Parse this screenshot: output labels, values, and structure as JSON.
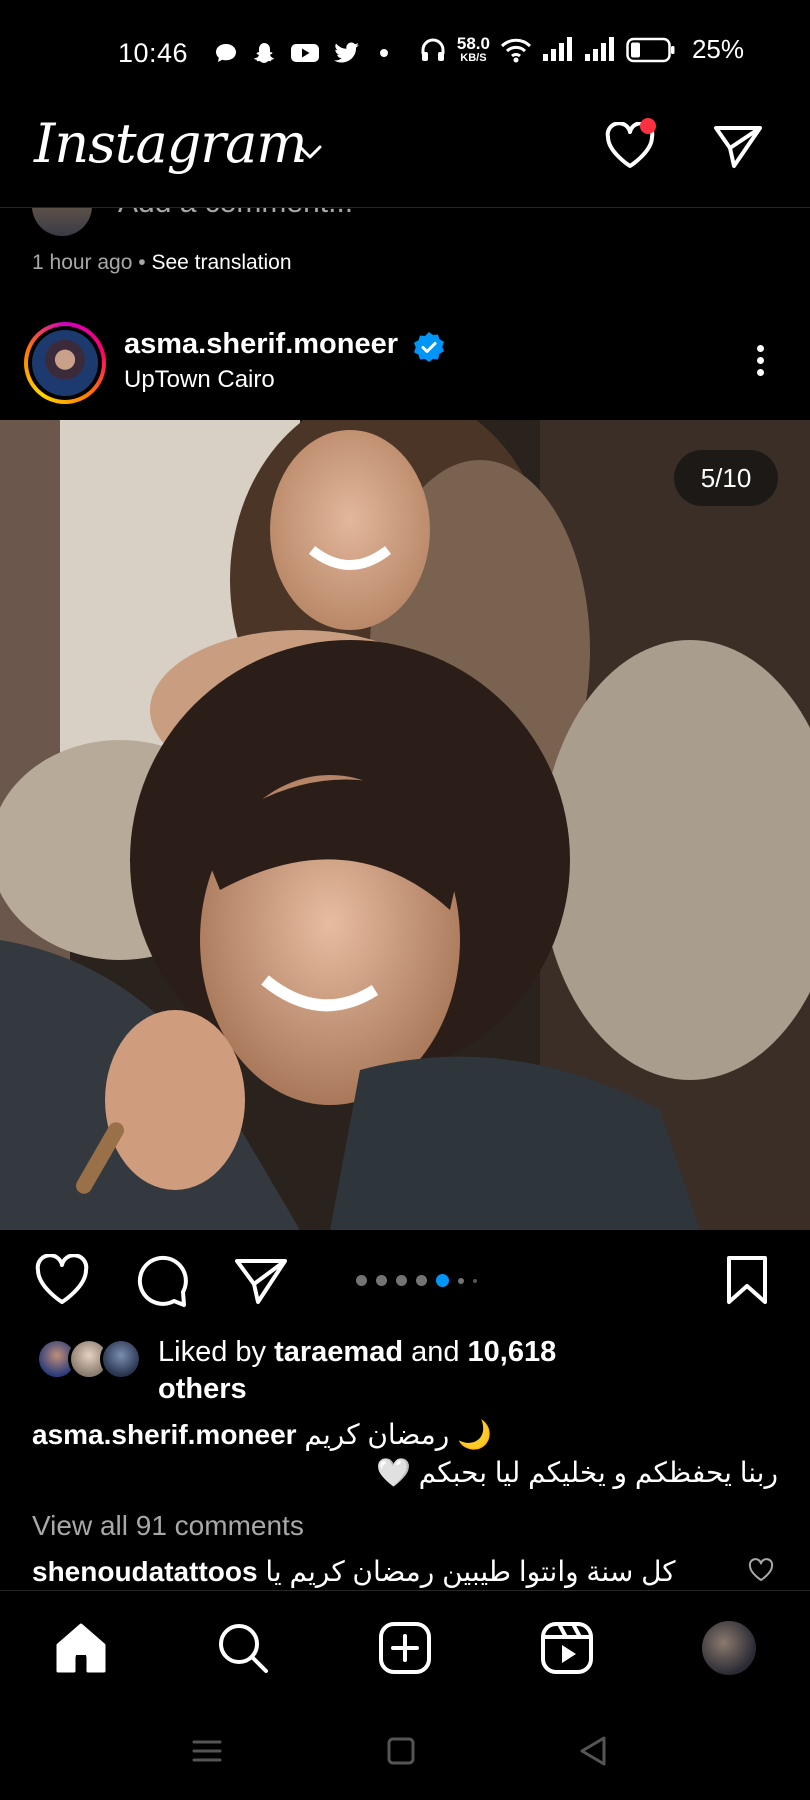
{
  "status_bar": {
    "time": "10:46",
    "net_speed_value": "58.0",
    "net_speed_unit": "KB/S",
    "battery": "25%",
    "notification_icons": [
      "chat-icon",
      "snapchat-icon",
      "youtube-icon",
      "twitter-icon",
      "dot-icon"
    ],
    "system_icons": [
      "headphones-icon",
      "wifi-icon",
      "signal-icon",
      "signal-icon",
      "battery-icon"
    ]
  },
  "header": {
    "logo": "Instagram",
    "has_notification": true
  },
  "previous_post": {
    "comment_placeholder": "Add a comment...",
    "time_ago": "1 hour ago",
    "separator": " • ",
    "see_translation": "See translation"
  },
  "post": {
    "username": "asma.sherif.moneer",
    "verified": true,
    "location": "UpTown Cairo",
    "carousel_counter": "5/10",
    "liked_by_prefix": "Liked by ",
    "liked_by_user": "taraemad",
    "liked_by_and": " and ",
    "liked_by_count": "10,618",
    "liked_by_others": "others",
    "caption_username": "asma.sherif.moneer",
    "caption_line1": "رمضان كريم 🌙",
    "caption_line2": "ربنا يحفظكم و يخليكم ليا بحبكم 🤍",
    "view_comments": "View all 91 comments",
    "top_comment_user": "shenoudatattoos",
    "top_comment_text": "كل سنة وانتوا طيبين رمضان كريم يا"
  },
  "colors": {
    "background": "#000000",
    "secondary_text": "#a8a8a8",
    "accent_blue": "#0095f6",
    "notification_red": "#ff3040"
  }
}
